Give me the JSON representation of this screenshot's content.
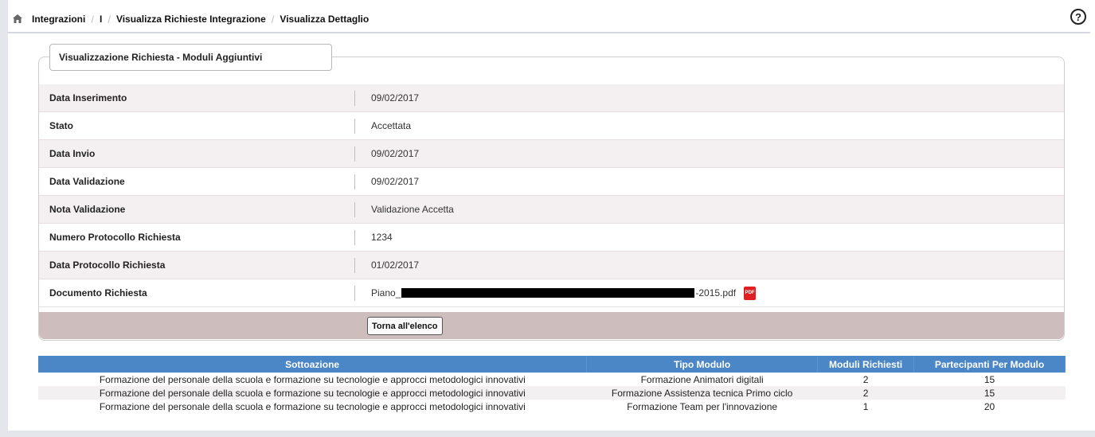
{
  "breadcrumb": {
    "items": [
      "Integrazioni",
      "I",
      "Visualizza Richieste Integrazione",
      "Visualizza Dettaglio"
    ]
  },
  "panel": {
    "title": "Visualizzazione Richiesta - Moduli Aggiuntivi",
    "fields": [
      {
        "label": "Data Inserimento",
        "value": "09/02/2017"
      },
      {
        "label": "Stato",
        "value": "Accettata"
      },
      {
        "label": "Data Invio",
        "value": "09/02/2017"
      },
      {
        "label": "Data Validazione",
        "value": "09/02/2017"
      },
      {
        "label": "Nota Validazione",
        "value": "Validazione Accetta"
      },
      {
        "label": "Numero Protocollo Richiesta",
        "value": "1234"
      },
      {
        "label": "Data Protocollo Richiesta",
        "value": "01/02/2017"
      },
      {
        "label": "Documento Richiesta",
        "value_prefix": "Piano_",
        "value_suffix": "-2015.pdf",
        "icon": "pdf-icon",
        "icon_text": "PDF"
      }
    ],
    "back_button": "Torna all'elenco"
  },
  "table": {
    "headers": [
      "Sottoazione",
      "Tipo Modulo",
      "Moduli Richiesti",
      "Partecipanti Per Modulo"
    ],
    "rows": [
      [
        "Formazione del personale della scuola e formazione su tecnologie e approcci metodologici innovativi",
        "Formazione Animatori digitali",
        "2",
        "15"
      ],
      [
        "Formazione del personale della scuola e formazione su tecnologie e approcci metodologici innovativi",
        "Formazione Assistenza tecnica Primo ciclo",
        "2",
        "15"
      ],
      [
        "Formazione del personale della scuola e formazione su tecnologie e approcci metodologici innovativi",
        "Formazione Team per l'innovazione",
        "1",
        "20"
      ]
    ]
  },
  "colors": {
    "table_header": "#4b86c6",
    "action_bar": "#cdbdbd",
    "row_alt": "#f4eff0",
    "pdf_icon": "#e02020"
  },
  "icons": [
    "home-icon",
    "help-icon",
    "pdf-icon"
  ]
}
